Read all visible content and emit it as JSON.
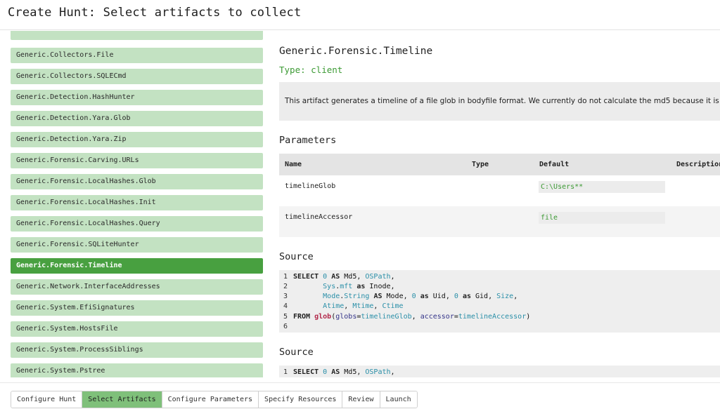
{
  "header": {
    "title": "Create Hunt: Select artifacts to collect"
  },
  "artifacts": [
    {
      "label": "Generic.Collectors.File",
      "selected": false
    },
    {
      "label": "Generic.Collectors.SQLECmd",
      "selected": false
    },
    {
      "label": "Generic.Detection.HashHunter",
      "selected": false
    },
    {
      "label": "Generic.Detection.Yara.Glob",
      "selected": false
    },
    {
      "label": "Generic.Detection.Yara.Zip",
      "selected": false
    },
    {
      "label": "Generic.Forensic.Carving.URLs",
      "selected": false
    },
    {
      "label": "Generic.Forensic.LocalHashes.Glob",
      "selected": false
    },
    {
      "label": "Generic.Forensic.LocalHashes.Init",
      "selected": false
    },
    {
      "label": "Generic.Forensic.LocalHashes.Query",
      "selected": false
    },
    {
      "label": "Generic.Forensic.SQLiteHunter",
      "selected": false
    },
    {
      "label": "Generic.Forensic.Timeline",
      "selected": true
    },
    {
      "label": "Generic.Network.InterfaceAddresses",
      "selected": false
    },
    {
      "label": "Generic.System.EfiSignatures",
      "selected": false
    },
    {
      "label": "Generic.System.HostsFile",
      "selected": false
    },
    {
      "label": "Generic.System.ProcessSiblings",
      "selected": false
    },
    {
      "label": "Generic.System.Pstree",
      "selected": false
    }
  ],
  "detail": {
    "title": "Generic.Forensic.Timeline",
    "type": "Type: client",
    "description": "This artifact generates a timeline of a file glob in bodyfile format. We currently do not calculate the md5 because it is",
    "parameters_heading": "Parameters",
    "columns": {
      "name": "Name",
      "type": "Type",
      "default": "Default",
      "description": "Description"
    },
    "params": [
      {
        "name": "timelineGlob",
        "type": "",
        "default": "C:\\Users**"
      },
      {
        "name": "timelineAccessor",
        "type": "",
        "default": "file"
      }
    ],
    "source_heading": "Source",
    "source_heading_2": "Source",
    "line_numbers": [
      "1",
      "2",
      "3",
      "4",
      "5",
      "6"
    ],
    "source2_line_number": "1"
  },
  "footer": {
    "tabs": [
      {
        "label": "Configure Hunt",
        "active": false
      },
      {
        "label": "Select Artifacts",
        "active": true
      },
      {
        "label": "Configure Parameters",
        "active": false
      },
      {
        "label": "Specify Resources",
        "active": false
      },
      {
        "label": "Review",
        "active": false
      },
      {
        "label": "Launch",
        "active": false
      }
    ]
  },
  "colors": {
    "selected_item": "#48a040",
    "list_item": "#c3e2c2",
    "type_text": "#3c9a34",
    "active_tab": "#7fc07a"
  }
}
